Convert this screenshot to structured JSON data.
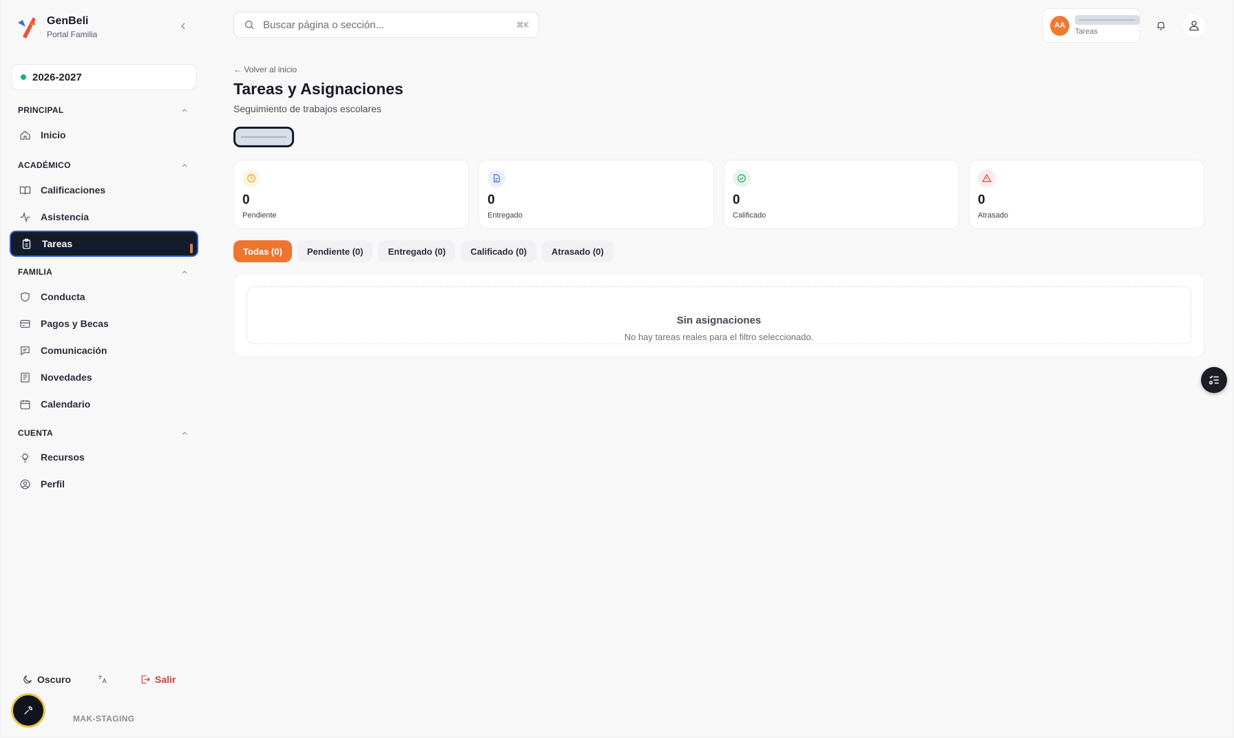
{
  "brand": {
    "name": "GenBeli",
    "subtitle": "Portal Familia"
  },
  "school_year": "2026-2027",
  "sidebar": {
    "sections": [
      {
        "title": "PRINCIPAL",
        "items": [
          {
            "label": "Inicio",
            "icon": "home-icon"
          }
        ]
      },
      {
        "title": "ACADÉMICO",
        "items": [
          {
            "label": "Calificaciones",
            "icon": "book-icon"
          },
          {
            "label": "Asistencia",
            "icon": "activity-icon"
          },
          {
            "label": "Tareas",
            "icon": "clipboard-icon",
            "active": true
          }
        ]
      },
      {
        "title": "FAMILIA",
        "items": [
          {
            "label": "Conducta",
            "icon": "shield-icon"
          },
          {
            "label": "Pagos y Becas",
            "icon": "credit-card-icon"
          },
          {
            "label": "Comunicación",
            "icon": "message-icon"
          },
          {
            "label": "Novedades",
            "icon": "newspaper-icon"
          },
          {
            "label": "Calendario",
            "icon": "calendar-icon"
          }
        ]
      },
      {
        "title": "CUENTA",
        "items": [
          {
            "label": "Recursos",
            "icon": "lightbulb-icon"
          },
          {
            "label": "Perfil",
            "icon": "user-circle-icon"
          }
        ]
      }
    ],
    "footer": {
      "theme_label": "Oscuro",
      "logout_label": "Salir",
      "env_label": "MAK-STAGING"
    }
  },
  "topbar": {
    "search_placeholder": "Buscar página o sección...",
    "shortcut": "⌘K",
    "user": {
      "initials": "AA",
      "role": "Tareas"
    }
  },
  "page": {
    "back_label": "← Volver al inicio",
    "title": "Tareas y Asignaciones",
    "subtitle": "Seguimiento de trabajos escolares"
  },
  "stats": [
    {
      "value": "0",
      "label": "Pendiente",
      "icon": "clock-icon",
      "color": "#e0a21b",
      "bg": "#fdf5e2"
    },
    {
      "value": "0",
      "label": "Entregado",
      "icon": "file-icon",
      "color": "#3a6fd8",
      "bg": "#e9f0fc"
    },
    {
      "value": "0",
      "label": "Calificado",
      "icon": "check-circle-icon",
      "color": "#1f9e5c",
      "bg": "#e6f6ee"
    },
    {
      "value": "0",
      "label": "Atrasado",
      "icon": "alert-triangle-icon",
      "color": "#d93a3a",
      "bg": "#fcebeb"
    }
  ],
  "filters": [
    {
      "label": "Todas (0)",
      "active": true
    },
    {
      "label": "Pendiente (0)"
    },
    {
      "label": "Entregado (0)"
    },
    {
      "label": "Calificado (0)"
    },
    {
      "label": "Atrasado (0)"
    }
  ],
  "empty_state": {
    "title": "Sin asignaciones",
    "description": "No hay tareas reales para el filtro seleccionado."
  },
  "colors": {
    "accent": "#ee7530",
    "active_nav": "#141b2b",
    "danger": "#d93a3a"
  }
}
